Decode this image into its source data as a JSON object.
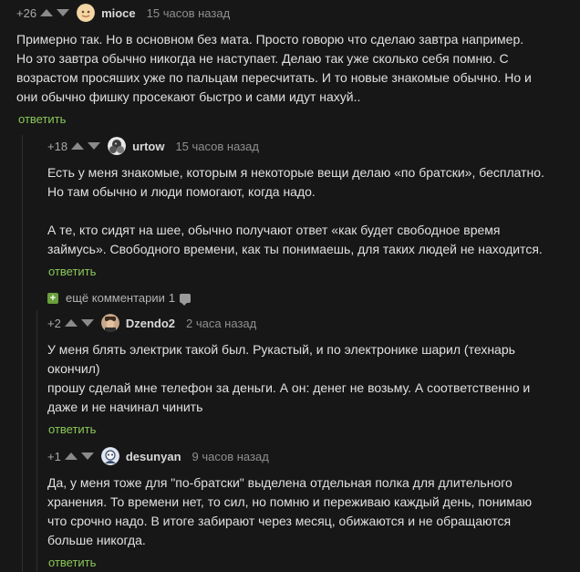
{
  "comments": [
    {
      "rating": "+26",
      "username": "mioce",
      "time": "15 часов назад",
      "body": "Примерно так. Но в основном без мата. Просто говорю что сделаю завтра например.\nНо это завтра обычно никогда не наступает. Делаю так уже сколько себя помню. С\nвозрастом просяших уже по пальцам пересчитать. И то новые знакомые обычно. Но и\nони обычно фишку просекают быстро и сами идут нахуй..",
      "reply": "ответить"
    },
    {
      "rating": "+18",
      "username": "urtow",
      "time": "15 часов назад",
      "body": "Есть у меня знакомые, которым я некоторые вещи делаю «по братски», бесплатно.\nНо там обычно и люди помогают, когда надо.\n\nА те, кто сидят на шее, обычно получают ответ «как будет свободное время\nзаймусь». Свободного времени, как ты понимаешь, для таких людей не находится.",
      "reply": "ответить"
    },
    {
      "rating": "+2",
      "username": "Dzendo2",
      "time": "2 часа назад",
      "body": "У меня блять электрик такой был. Рукастый, и по электронике шарил (технарь\nокончил)\nпрошу сделай мне телефон за деньги. А он: денег не возьму. А соответственно и\nдаже и не начинал чинить",
      "reply": "ответить"
    },
    {
      "rating": "+1",
      "username": "desunyan",
      "time": "9 часов назад",
      "body": "Да, у меня тоже для \"по-братски\" выделена отдельная полка для длительного\nхранения. То времени нет, то сил, но помню и переживаю каждый день, понимаю\nчто срочно надо. В итоге забирают через месяц, обижаются и не обращаются\nбольше никогда.",
      "reply": "ответить"
    }
  ],
  "more_comments": {
    "label": "ещё комментарии",
    "count": "1"
  }
}
